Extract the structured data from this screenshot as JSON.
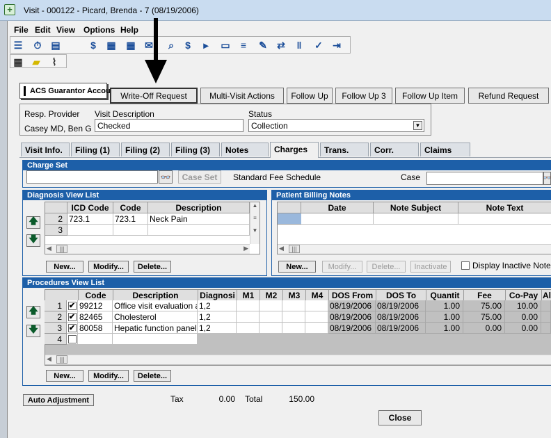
{
  "window": {
    "title": "Visit - 000122 - Picard, Brenda - 7 (08/19/2006)"
  },
  "menu": [
    "File",
    "Edit",
    "View",
    "Options",
    "Help"
  ],
  "toolbar_icons": [
    "list-icon",
    "stopwatch-icon",
    "form-icon",
    "dollar-icon",
    "payment-icon",
    "calculator-icon",
    "envelope-icon",
    "search-icon",
    "search-dollar-icon",
    "folder-go-icon",
    "folder-open-icon",
    "report-icon",
    "wrench-icon",
    "transfer-icon",
    "chart-icon",
    "checklist-icon",
    "export-icon"
  ],
  "toolbar2_icons": [
    "keyboard-icon",
    "sticky-note-icon",
    "paperclip-icon"
  ],
  "top_buttons": {
    "acs": "ACS Guarantor Account",
    "writeoff": "Write-Off Request",
    "multivisit": "Multi-Visit Actions",
    "followup": "Follow Up",
    "followup3": "Follow Up 3",
    "followupitem": "Follow Up Item",
    "refund": "Refund Request"
  },
  "info": {
    "resp_provider_label": "Resp. Provider",
    "resp_provider_value": "Casey MD, Ben G",
    "visit_desc_label": "Visit Description",
    "visit_desc_value": "Checked",
    "status_label": "Status",
    "status_value": "Collection"
  },
  "tabs": [
    "Visit Info.",
    "Filing (1)",
    "Filing (2)",
    "Filing (3)",
    "Notes",
    "Charges",
    "Trans.",
    "Corr.",
    "Claims"
  ],
  "charge_set": {
    "title": "Charge Set",
    "case_set_button": "Case Set",
    "fee_schedule": "Standard Fee Schedule",
    "case_label": "Case"
  },
  "diagnosis": {
    "title": "Diagnosis View List",
    "headers": [
      "ICD Code",
      "Code",
      "Description"
    ],
    "rows": [
      {
        "n": "2",
        "icd": "723.1",
        "code": "723.1",
        "desc": "Neck Pain"
      },
      {
        "n": "3",
        "icd": "",
        "code": "",
        "desc": ""
      }
    ],
    "buttons": {
      "new": "New...",
      "modify": "Modify...",
      "delete": "Delete..."
    }
  },
  "billing_notes": {
    "title": "Patient Billing Notes",
    "headers": [
      "Date",
      "Note Subject",
      "Note Text"
    ],
    "buttons": {
      "new": "New...",
      "modify": "Modify...",
      "delete": "Delete...",
      "inactivate": "Inactivate"
    },
    "checkbox_label": "Display Inactive Notes"
  },
  "procedures": {
    "title": "Procedures View List",
    "headers": [
      "Code",
      "Description",
      "Diagnosi",
      "M1",
      "M2",
      "M3",
      "M4",
      "DOS From",
      "DOS To",
      "Quantit",
      "Fee",
      "Co-Pay",
      "All"
    ],
    "rows": [
      {
        "n": "1",
        "check": "✔",
        "code": "99212",
        "desc": "Office visit evaluation and",
        "diag": "1,2",
        "from": "08/19/2006",
        "to": "08/19/2006",
        "qty": "1.00",
        "fee": "75.00",
        "copay": "10.00"
      },
      {
        "n": "2",
        "check": "✔",
        "code": "82465",
        "desc": "Cholesterol",
        "diag": "1,2",
        "from": "08/19/2006",
        "to": "08/19/2006",
        "qty": "1.00",
        "fee": "75.00",
        "copay": "0.00"
      },
      {
        "n": "3",
        "check": "✔",
        "code": "80058",
        "desc": "Hepatic function panel T",
        "diag": "1,2",
        "from": "08/19/2006",
        "to": "08/19/2006",
        "qty": "1.00",
        "fee": "0.00",
        "copay": "0.00"
      },
      {
        "n": "4",
        "check": "",
        "code": "",
        "desc": "",
        "diag": "",
        "from": "",
        "to": "",
        "qty": "",
        "fee": "",
        "copay": ""
      }
    ],
    "buttons": {
      "new": "New...",
      "modify": "Modify...",
      "delete": "Delete..."
    }
  },
  "footer": {
    "auto_adjustment": "Auto Adjustment",
    "tax_label": "Tax",
    "tax_value": "0.00",
    "total_label": "Total",
    "total_value": "150.00",
    "close": "Close"
  }
}
